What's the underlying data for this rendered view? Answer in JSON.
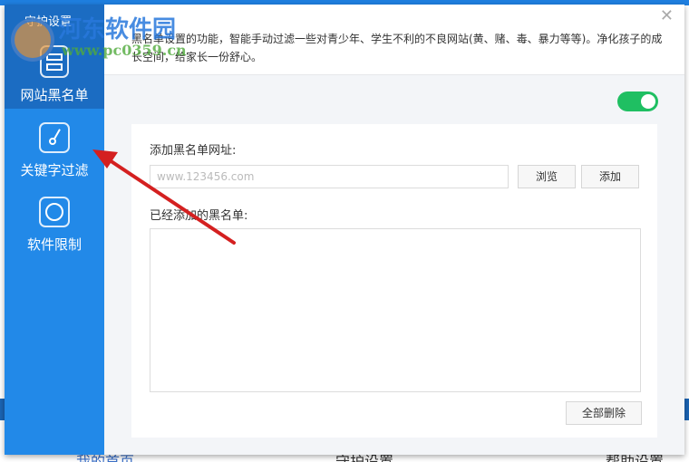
{
  "background_app": {
    "bottom_items": [
      "我的首页",
      "守护设置",
      "帮助设置"
    ]
  },
  "dialog": {
    "title": "守护设置",
    "close_icon": "close-icon",
    "sidebar": {
      "items": [
        {
          "label": "网站黑名单",
          "icon": "list-icon",
          "active": true
        },
        {
          "label": "关键字过滤",
          "icon": "key-icon",
          "active": false
        },
        {
          "label": "软件限制",
          "icon": "software-icon",
          "active": false
        }
      ]
    },
    "description": "黑名单设置的功能，智能手动过滤一些对青少年、学生不利的不良网站(黄、赌、毒、暴力等等)。净化孩子的成长空间，给家长一份舒心。",
    "toggle_on": true,
    "add_label": "添加黑名单网址:",
    "url_placeholder": "www.123456.com",
    "browse_label": "浏览",
    "add_button": "添加",
    "added_label": "已经添加的黑名单:",
    "delete_all": "全部删除"
  },
  "watermark": {
    "title": "河东软件园",
    "url": "www.pc0359.cn"
  },
  "colors": {
    "sidebar": "#2289e8",
    "active": "#1b6cc2",
    "toggle": "#1fbf62",
    "arrow": "#d42020"
  }
}
